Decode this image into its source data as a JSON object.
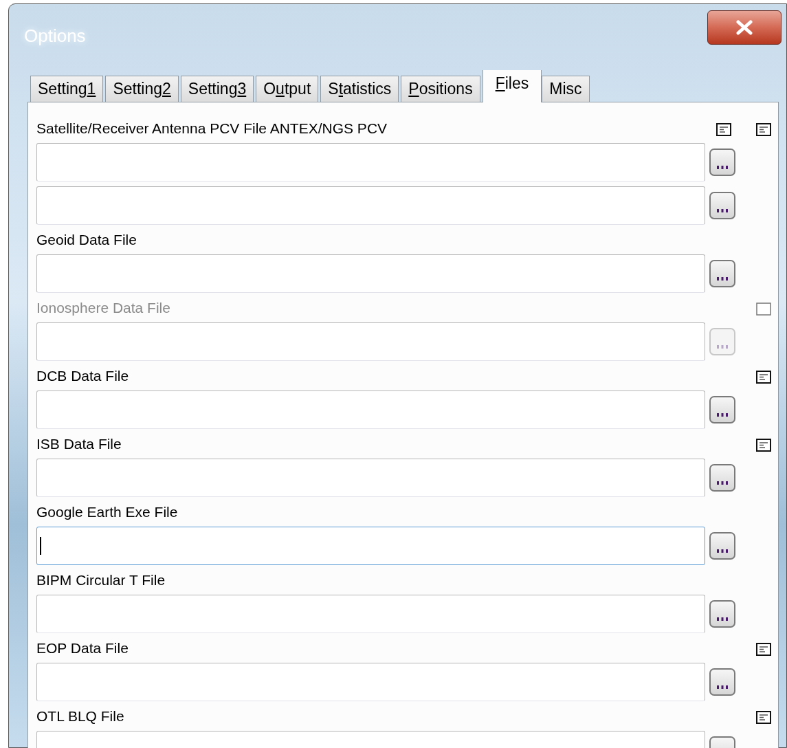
{
  "window": {
    "title": "Options"
  },
  "tabs": [
    {
      "before": "Setting",
      "key": "1",
      "selected": false
    },
    {
      "before": "Setting",
      "key": "2",
      "selected": false
    },
    {
      "before": "Setting",
      "key": "3",
      "selected": false
    },
    {
      "before": "O",
      "key": "u",
      "after": "tput",
      "selected": false
    },
    {
      "before": "S",
      "key": "t",
      "after": "atistics",
      "selected": false
    },
    {
      "key": "P",
      "after": "ositions",
      "selected": false
    },
    {
      "key": "F",
      "after": "iles",
      "selected": true
    },
    {
      "before": "Misc",
      "selected": false
    }
  ],
  "sections": [
    {
      "label": "Satellite/Receiver Antenna PCV File ANTEX/NGS PCV",
      "disabled": false,
      "view_icons": [
        {
          "enabled": true
        },
        {
          "enabled": true
        }
      ],
      "fields": [
        {
          "focused": false
        },
        {
          "focused": false
        }
      ]
    },
    {
      "label": "Geoid Data File",
      "disabled": false,
      "fields": [
        {
          "focused": false
        }
      ]
    },
    {
      "label": "Ionosphere Data File",
      "disabled": true,
      "view_icons": [
        {
          "enabled": false
        }
      ],
      "fields": [
        {
          "focused": false
        }
      ]
    },
    {
      "label": "DCB Data File",
      "disabled": false,
      "view_icons": [
        {
          "enabled": true
        }
      ],
      "fields": [
        {
          "focused": false
        }
      ]
    },
    {
      "label": "ISB Data File",
      "disabled": false,
      "view_icons": [
        {
          "enabled": true
        }
      ],
      "fields": [
        {
          "focused": false
        }
      ]
    },
    {
      "label": "Google Earth Exe File",
      "disabled": false,
      "fields": [
        {
          "focused": true
        }
      ]
    },
    {
      "label": "BIPM Circular T File",
      "disabled": false,
      "fields": [
        {
          "focused": false
        }
      ]
    },
    {
      "label": "EOP Data File",
      "disabled": false,
      "view_icons": [
        {
          "enabled": true
        }
      ],
      "fields": [
        {
          "focused": false
        }
      ]
    },
    {
      "label": "OTL BLQ File",
      "disabled": false,
      "view_icons": [
        {
          "enabled": true
        }
      ],
      "fields": [
        {
          "focused": false
        }
      ]
    }
  ]
}
